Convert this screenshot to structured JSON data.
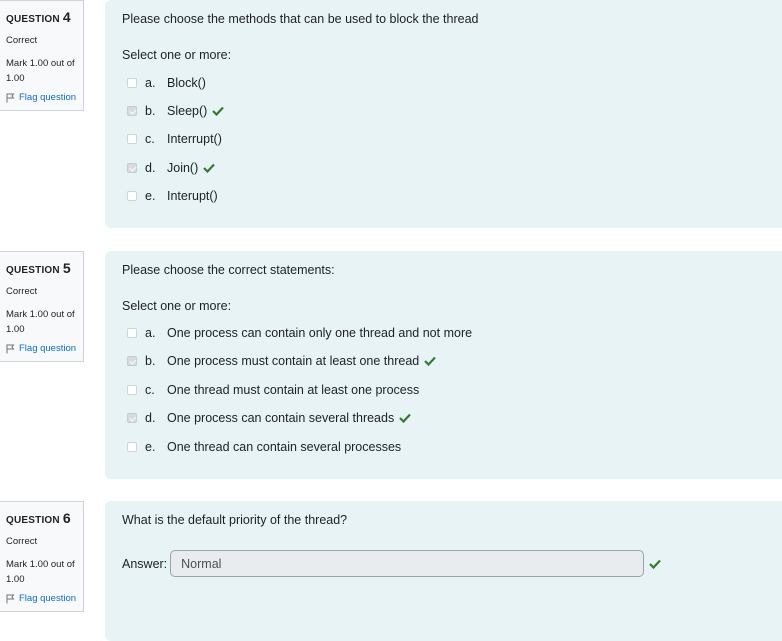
{
  "questions": [
    {
      "label": "QUESTION",
      "number": "4",
      "state": "Correct",
      "grade": "Mark 1.00 out of 1.00",
      "flag": "Flag question",
      "text": "Please choose the methods that can be used to block the thread",
      "prompt": "Select one or more:",
      "answers": [
        {
          "letter": "a.",
          "text": "Block()",
          "checked": false,
          "correct": false
        },
        {
          "letter": "b.",
          "text": "Sleep()",
          "checked": true,
          "correct": true
        },
        {
          "letter": "c.",
          "text": "Interrupt()",
          "checked": false,
          "correct": false
        },
        {
          "letter": "d.",
          "text": "Join()",
          "checked": true,
          "correct": true
        },
        {
          "letter": "e.",
          "text": "Interupt()",
          "checked": false,
          "correct": false
        }
      ]
    },
    {
      "label": "QUESTION",
      "number": "5",
      "state": "Correct",
      "grade": "Mark 1.00 out of 1.00",
      "flag": "Flag question",
      "text": "Please choose the correct statements:",
      "prompt": "Select one or more:",
      "answers": [
        {
          "letter": "a.",
          "text": "One process can contain only one thread and not more",
          "checked": false,
          "correct": false
        },
        {
          "letter": "b.",
          "text": "One process must contain at least one thread",
          "checked": true,
          "correct": true
        },
        {
          "letter": "c.",
          "text": "One thread must contain at least one process",
          "checked": false,
          "correct": false
        },
        {
          "letter": "d.",
          "text": "One process can contain several threads",
          "checked": true,
          "correct": true
        },
        {
          "letter": "e.",
          "text": "One thread can contain several processes",
          "checked": false,
          "correct": false
        }
      ]
    },
    {
      "label": "QUESTION",
      "number": "6",
      "state": "Correct",
      "grade": "Mark 1.00 out of 1.00",
      "flag": "Flag question",
      "text": "What is the default priority of the thread?",
      "answer_label": "Answer:",
      "answer_value": "Normal",
      "correct": true
    }
  ],
  "colors": {
    "accent": "#0f6cbf",
    "correct": "#357a32",
    "content_bg": "#e7f3f5"
  }
}
